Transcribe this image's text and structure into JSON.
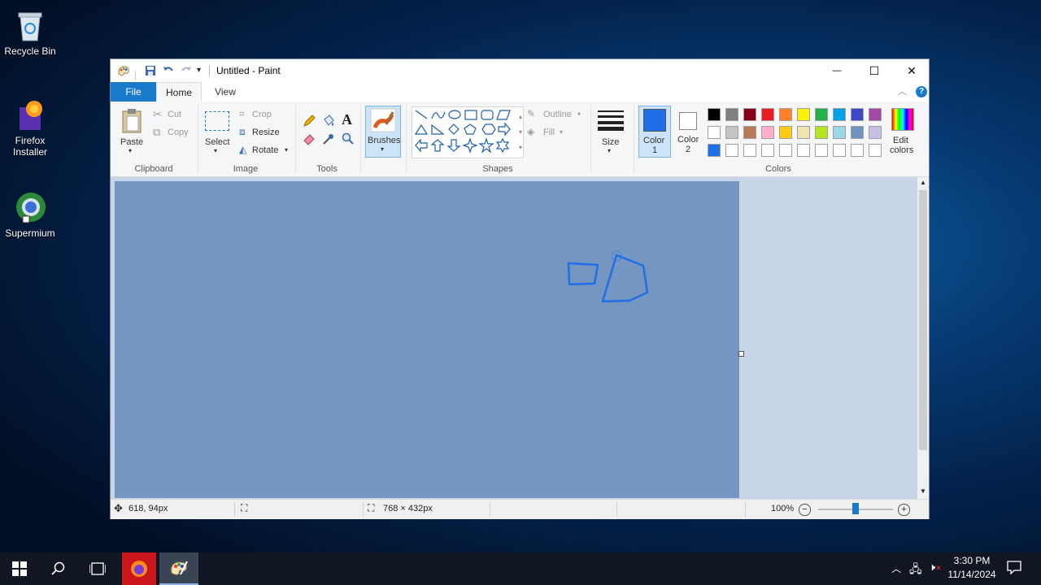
{
  "desktop": {
    "icons": [
      {
        "label": "Recycle Bin",
        "icon": "recycle-bin-icon"
      },
      {
        "label": "Firefox Installer",
        "icon": "firefox-installer-icon"
      },
      {
        "label": "Supermium",
        "icon": "supermium-icon"
      }
    ]
  },
  "window": {
    "title": "Untitled - Paint",
    "controls": {
      "minimize": "—",
      "maximize": "☐",
      "close": "✕"
    }
  },
  "tabs": {
    "file": "File",
    "home": "Home",
    "view": "View"
  },
  "ribbon": {
    "clipboard": {
      "paste": "Paste",
      "cut": "Cut",
      "copy": "Copy",
      "group": "Clipboard"
    },
    "image": {
      "select": "Select",
      "crop": "Crop",
      "resize": "Resize",
      "rotate": "Rotate",
      "group": "Image"
    },
    "tools": {
      "group": "Tools"
    },
    "brushes": {
      "label": "Brushes"
    },
    "shapes": {
      "outline": "Outline",
      "fill": "Fill",
      "group": "Shapes"
    },
    "size": {
      "label": "Size"
    },
    "colors": {
      "color1_label": "Color",
      "color1_num": "1",
      "color2_label": "Color",
      "color2_num": "2",
      "edit": "Edit",
      "edit2": "colors",
      "group": "Colors",
      "color1_value": "#1f6fe8",
      "color2_value": "#ffffff",
      "palette_row1": [
        "#000000",
        "#7f7f7f",
        "#880015",
        "#ed1c24",
        "#ff7f27",
        "#fff200",
        "#22b14c",
        "#00a2e8",
        "#3f48cc",
        "#a349a4"
      ],
      "palette_row2": [
        "#ffffff",
        "#c3c3c3",
        "#b97a57",
        "#ffaec9",
        "#ffc90e",
        "#efe4b0",
        "#b5e61d",
        "#99d9ea",
        "#7092be",
        "#c8bfe7"
      ],
      "palette_row3": [
        "#1f6fe8",
        "#ffffff",
        "#ffffff",
        "#ffffff",
        "#ffffff",
        "#ffffff",
        "#ffffff",
        "#ffffff",
        "#ffffff",
        "#ffffff"
      ]
    }
  },
  "status": {
    "cursor_pos": "618, 94px",
    "canvas_size": "768 × 432px",
    "zoom": "100%",
    "zoom_level": 0.5
  },
  "taskbar": {
    "time": "3:30 PM",
    "date": "11/14/2024"
  }
}
